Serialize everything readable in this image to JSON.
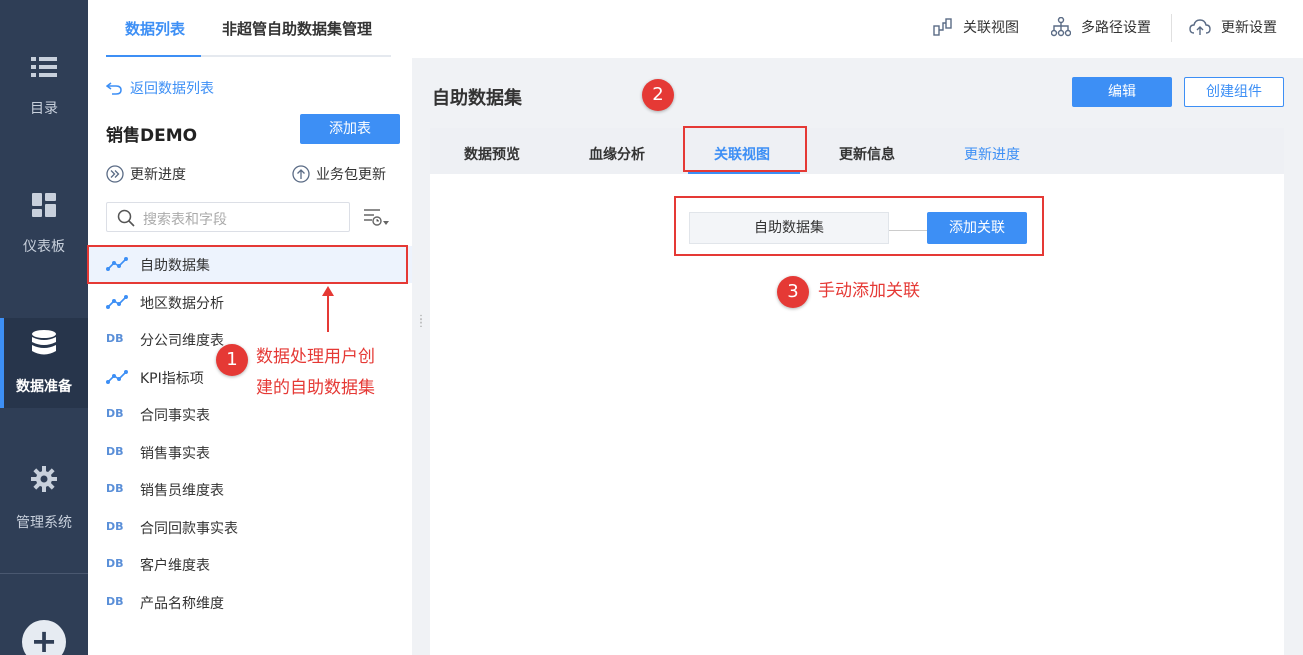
{
  "leftnav": {
    "items": [
      {
        "label": "目录",
        "icon": "list-icon"
      },
      {
        "label": "仪表板",
        "icon": "dashboard-icon"
      },
      {
        "label": "数据准备",
        "icon": "database-icon",
        "active": true
      },
      {
        "label": "管理系统",
        "icon": "gear-icon"
      }
    ],
    "plus_label": "+"
  },
  "topbar": {
    "tabs": [
      {
        "label": "数据列表",
        "active": true
      },
      {
        "label": "非超管自助数据集管理"
      }
    ],
    "actions": [
      {
        "label": "关联视图",
        "icon": "relation-view-icon"
      },
      {
        "label": "多路径设置",
        "icon": "multipath-icon"
      },
      {
        "label": "更新设置",
        "icon": "cloud-update-icon"
      }
    ]
  },
  "sidebar": {
    "back_label": "返回数据列表",
    "title": "销售DEMO",
    "add_table_label": "添加表",
    "update_progress_label": "更新进度",
    "package_update_label": "业务包更新",
    "search_placeholder": "搜索表和字段",
    "tables": [
      {
        "label": "自助数据集",
        "type": "self-service",
        "selected": true
      },
      {
        "label": "地区数据分析",
        "type": "self-service"
      },
      {
        "label": "分公司维度表",
        "type": "db"
      },
      {
        "label": "KPI指标项",
        "type": "self-service"
      },
      {
        "label": "合同事实表",
        "type": "db"
      },
      {
        "label": "销售事实表",
        "type": "db"
      },
      {
        "label": "销售员维度表",
        "type": "db"
      },
      {
        "label": "合同回款事实表",
        "type": "db"
      },
      {
        "label": "客户维度表",
        "type": "db"
      },
      {
        "label": "产品名称维度",
        "type": "db"
      }
    ],
    "db_icon_text": "DB"
  },
  "content": {
    "title": "自助数据集",
    "edit_label": "编辑",
    "create_component_label": "创建组件",
    "tabs": [
      {
        "label": "数据预览"
      },
      {
        "label": "血缘分析"
      },
      {
        "label": "关联视图",
        "active": true
      },
      {
        "label": "更新信息"
      },
      {
        "label": "更新进度",
        "link": true
      }
    ],
    "relation_node_label": "自助数据集",
    "add_relation_label": "添加关联"
  },
  "annotations": {
    "marker1": "1",
    "marker1_text_line1": "数据处理用户创",
    "marker1_text_line2": "建的自助数据集",
    "marker2": "2",
    "marker3": "3",
    "marker3_text": "手动添加关联",
    "color": "#e53935"
  },
  "colors": {
    "accent": "#3d8ff5",
    "nav_bg": "#2f3e56",
    "annotation_red": "#e53935"
  }
}
